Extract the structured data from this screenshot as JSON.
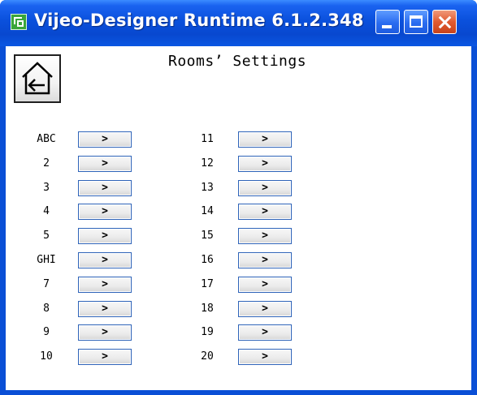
{
  "window": {
    "title": "Vijeo-Designer Runtime 6.1.2.348",
    "controls": {
      "minimize": "minimize",
      "maximize": "maximize",
      "close": "close"
    }
  },
  "screen": {
    "title": "Rooms’ Settings",
    "home_icon": "home-back-icon"
  },
  "rooms_left": [
    {
      "label": "ABC",
      "button": ">"
    },
    {
      "label": "2",
      "button": ">"
    },
    {
      "label": "3",
      "button": ">"
    },
    {
      "label": "4",
      "button": ">"
    },
    {
      "label": "5",
      "button": ">"
    },
    {
      "label": "GHI",
      "button": ">"
    },
    {
      "label": "7",
      "button": ">"
    },
    {
      "label": "8",
      "button": ">"
    },
    {
      "label": "9",
      "button": ">"
    },
    {
      "label": "10",
      "button": ">"
    }
  ],
  "rooms_right": [
    {
      "label": "11",
      "button": ">"
    },
    {
      "label": "12",
      "button": ">"
    },
    {
      "label": "13",
      "button": ">"
    },
    {
      "label": "14",
      "button": ">"
    },
    {
      "label": "15",
      "button": ">"
    },
    {
      "label": "16",
      "button": ">"
    },
    {
      "label": "17",
      "button": ">"
    },
    {
      "label": "18",
      "button": ">"
    },
    {
      "label": "19",
      "button": ">"
    },
    {
      "label": "20",
      "button": ">"
    }
  ],
  "colors": {
    "titlebar": "#0a50dc",
    "close_button": "#e05a30",
    "button_border": "#2e63b8"
  }
}
